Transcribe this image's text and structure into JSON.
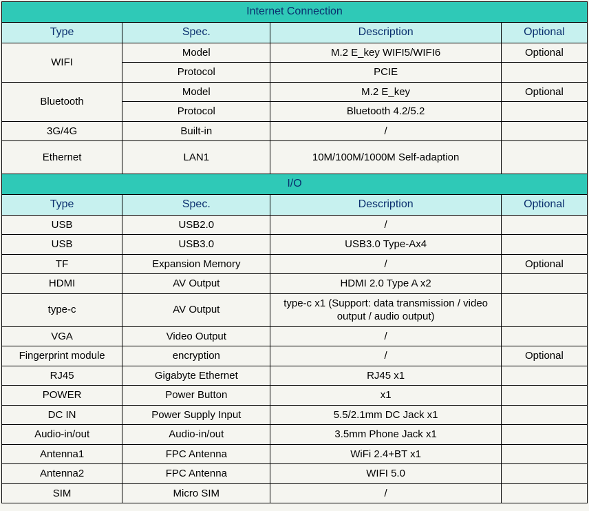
{
  "sections": [
    {
      "title": "Internet Connection",
      "headers": [
        "Type",
        "Spec.",
        "Description",
        "Optional"
      ],
      "rows": [
        {
          "type": "WIFI",
          "typeRowspan": 2,
          "spec": "Model",
          "desc": "M.2 E_key WIFI5/WIFI6",
          "opt": "Optional"
        },
        {
          "type": null,
          "spec": "Protocol",
          "desc": "PCIE",
          "opt": ""
        },
        {
          "type": "Bluetooth",
          "typeRowspan": 2,
          "spec": "Model",
          "desc": "M.2 E_key",
          "opt": "Optional"
        },
        {
          "type": null,
          "spec": "Protocol",
          "desc": "Bluetooth 4.2/5.2",
          "opt": ""
        },
        {
          "type": "3G/4G",
          "spec": "Built-in",
          "desc": "/",
          "opt": ""
        },
        {
          "type": "Ethernet",
          "tall": true,
          "spec": "LAN1",
          "desc": "10M/100M/1000M Self-adaption",
          "opt": ""
        }
      ]
    },
    {
      "title": "I/O",
      "headers": [
        "Type",
        "Spec.",
        "Description",
        "Optional"
      ],
      "rows": [
        {
          "type": "USB",
          "spec": "USB2.0",
          "desc": "/",
          "opt": ""
        },
        {
          "type": "USB",
          "spec": "USB3.0",
          "desc": "USB3.0 Type-Ax4",
          "opt": ""
        },
        {
          "type": "TF",
          "spec": "Expansion Memory",
          "desc": "/",
          "opt": "Optional"
        },
        {
          "type": "HDMI",
          "spec": "AV Output",
          "desc": "HDMI 2.0 Type A  x2",
          "opt": ""
        },
        {
          "type": "type-c",
          "spec": "AV Output",
          "desc": "type-c x1 (Support:   data transmission / video output / audio output)",
          "opt": ""
        },
        {
          "type": "VGA",
          "spec": "Video Output",
          "desc": "/",
          "opt": ""
        },
        {
          "type": "Fingerprint module",
          "spec": "encryption",
          "desc": "/",
          "opt": "Optional"
        },
        {
          "type": "RJ45",
          "spec": "Gigabyte Ethernet",
          "desc": "RJ45 x1",
          "opt": ""
        },
        {
          "type": "POWER",
          "spec": "Power Button",
          "desc": "x1",
          "opt": ""
        },
        {
          "type": "DC IN",
          "spec": "Power Supply Input",
          "desc": "5.5/2.1mm DC Jack x1",
          "opt": ""
        },
        {
          "type": "Audio-in/out",
          "spec": "Audio-in/out",
          "desc": "3.5mm Phone Jack x1",
          "opt": ""
        },
        {
          "type": "Antenna1",
          "spec": "FPC Antenna",
          "desc": "WiFi 2.4+BT x1",
          "opt": ""
        },
        {
          "type": "Antenna2",
          "spec": "FPC Antenna",
          "desc": "WIFI 5.0",
          "opt": ""
        },
        {
          "type": "SIM",
          "spec": "Micro SIM",
          "desc": "/",
          "opt": ""
        }
      ]
    }
  ]
}
